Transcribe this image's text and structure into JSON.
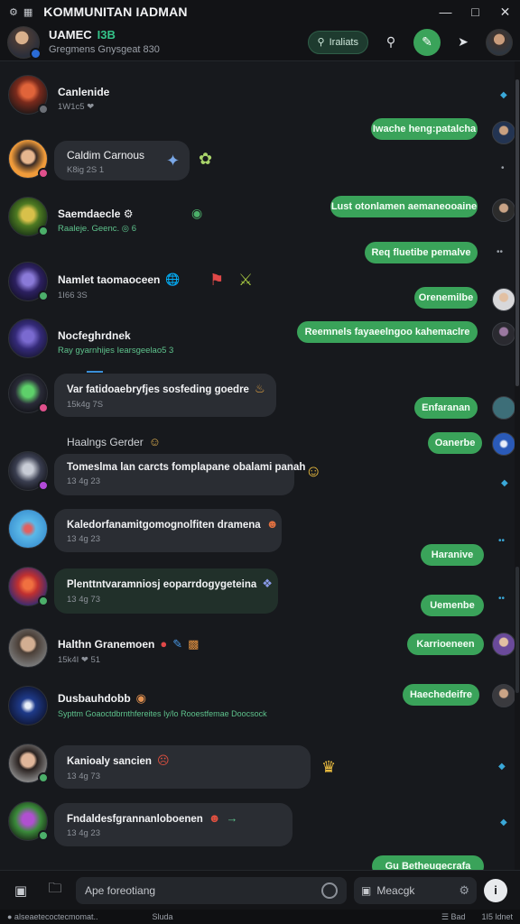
{
  "window": {
    "title": "KOMMUNITAN IADMAN",
    "icons": [
      "settings-icon",
      "grid-icon"
    ]
  },
  "header": {
    "name": "UAMEC",
    "name_accent": "I3B",
    "subtitle": "Gregmens Gnysgeat 830",
    "action_pill": "Iraliats"
  },
  "contacts": [
    {
      "name": "Canlenide",
      "sub": "1W1c5 ❤"
    },
    {
      "name": "Caldim Carnous",
      "sub": "K8ig 2S 1"
    },
    {
      "name": "Saemdaecle ⚙",
      "sub": "Raaleje. Geenc. ◎ 6"
    },
    {
      "name": "Namlet taomaoceen",
      "sub": "1I66 3S"
    },
    {
      "name": "Nocfeghrdnek",
      "sub": "Ray gyarnhijes Iearsgeelao5 3"
    },
    {
      "name": "Var fatidoaebryfjes sosfeding goedre",
      "sub": "15k4g 7S"
    },
    {
      "name": "Haalngs Gerder",
      "sub": ""
    },
    {
      "name": "Tomeslma lan carcts fomplapane obalami panah",
      "sub": "13 4g 23"
    },
    {
      "name": "Kaledorfanamitgomognolfiten dramena",
      "sub": "13 4g 23"
    },
    {
      "name": "Plenttntvaramniosj eoparrdogygeteina",
      "sub": "13 4g 73"
    },
    {
      "name": "Halthn Granemoen",
      "sub": "15k4I ❤ 51"
    },
    {
      "name": "Dusbauhdobb",
      "sub": "Sypttm Goaoctdbrnthfereites Iy/lo Rooestfemae Doocsock"
    },
    {
      "name": "Kanioaly sancien",
      "sub": "13 4g 73"
    },
    {
      "name": "Fndaldesfgrannanloboenen",
      "sub": "13 4g 23"
    }
  ],
  "outgoing": [
    "Iwache heng:patalcha",
    "Lust otonlamen aemaneooaine",
    "Req fluetibe pemalve",
    "Orenemilbe",
    "Reemnels fayaeelngoo kahemaclre",
    "Enfaranan",
    "Oanerbe",
    "Haranive",
    "Uemenbe",
    "Karrioeneen",
    "Haechedeifre",
    "Gu Betheugecrafa"
  ],
  "composer": {
    "placeholder": "Ape foreotiang",
    "secondary_placeholder": "Meacgk"
  },
  "statusbar": {
    "left": "● alseaetecoctecmomat..",
    "mid": "Sluda",
    "right1": "☰ Bad",
    "right2": "1I5 ldnet"
  },
  "colors": {
    "accent_green": "#3aa35a",
    "link_blue": "#3aa8d8",
    "background": "#17191d"
  }
}
